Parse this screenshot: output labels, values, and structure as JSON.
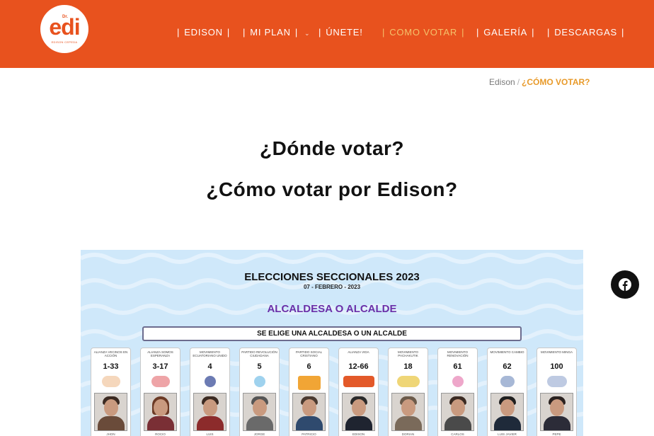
{
  "header": {
    "logo": {
      "prefix": "Dr.",
      "word": "edi",
      "subtitle": "EDISON CEPEDA"
    },
    "nav": [
      {
        "label": "EDISON",
        "active": false,
        "has_dropdown": false
      },
      {
        "label": "MI PLAN",
        "active": false,
        "has_dropdown": true
      },
      {
        "label": "ÚNETE!",
        "active": false,
        "has_dropdown": false
      },
      {
        "label": "COMO VOTAR",
        "active": true,
        "has_dropdown": false
      },
      {
        "label": "GALERÍA",
        "active": false,
        "has_dropdown": false
      },
      {
        "label": "DESCARGAS",
        "active": false,
        "has_dropdown": false
      }
    ],
    "separator": "|"
  },
  "breadcrumb": {
    "home": "Edison",
    "separator": "/",
    "current": "¿CÓMO VOTAR?"
  },
  "headings": {
    "title": "¿Dónde votar?",
    "subtitle": "¿Cómo votar por Edison?"
  },
  "ballot": {
    "title": "ELECCIONES SECCIONALES 2023",
    "date": "07 - FEBRERO - 2023",
    "office": "ALCALDESA O ALCALDE",
    "rule": "SE ELIGE UNA ALCALDESA O UN ALCALDE",
    "candidates": [
      {
        "org": "ALIANZA VECINOS EN ACCIÓN",
        "list": "1-33",
        "name": "JHON"
      },
      {
        "org": "ALIANZA SOMOS ESPERANZA",
        "list": "3-17",
        "name": "ROCIO"
      },
      {
        "org": "MOVIMIENTO ECUATORIANO UNIDO",
        "list": "4",
        "name": "LUIS"
      },
      {
        "org": "PARTIDO REVOLUCIÓN CIUDADANA",
        "list": "5",
        "name": "JORGE"
      },
      {
        "org": "PARTIDO SOCIAL CRISTIANO",
        "list": "6",
        "name": "PATRICIO"
      },
      {
        "org": "ALIANZA VIDA",
        "list": "12-66",
        "name": "EDISON"
      },
      {
        "org": "MOVIMIENTO PACHAKUTIK",
        "list": "18",
        "name": "DORIAN"
      },
      {
        "org": "MOVIMIENTO RENOVACIÓN",
        "list": "61",
        "name": "CARLOS"
      },
      {
        "org": "MOVIMIENTO CAMBIO",
        "list": "62",
        "name": "LUIS JAVIER"
      },
      {
        "org": "MOVIMIENTO MINGA",
        "list": "100",
        "name": "PEPE"
      }
    ]
  },
  "social": {
    "icon": "facebook-icon"
  },
  "colors": {
    "brand": "#e8521e",
    "nav_active": "#f4c26b",
    "breadcrumb_current": "#e89a2a",
    "ballot_accent": "#6a2fa8"
  }
}
